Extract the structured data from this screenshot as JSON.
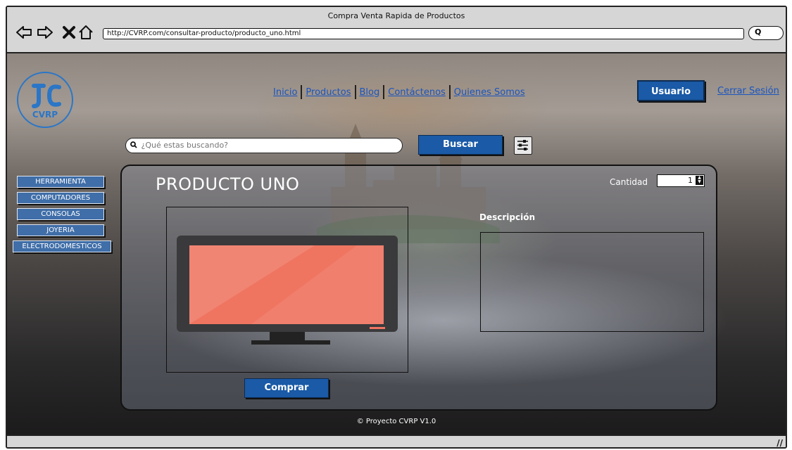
{
  "browser": {
    "window_title": "Compra Venta Rapida de Productos",
    "url": "http://CVRP.com/consultar-producto/producto_uno.html",
    "search_pill_glyph": "Q"
  },
  "header": {
    "logo_text": "CVRP",
    "nav": [
      {
        "label": "Inicio"
      },
      {
        "label": "Productos"
      },
      {
        "label": "Blog"
      },
      {
        "label": "Contáctenos"
      },
      {
        "label": "Quienes Somos"
      }
    ],
    "user_button": "Usuario",
    "logout_link": "Cerrar Sesión"
  },
  "search": {
    "placeholder": "¿Qué estas buscando?",
    "button": "Buscar"
  },
  "categories": [
    {
      "label": "HERRAMIENTA"
    },
    {
      "label": "COMPUTADORES"
    },
    {
      "label": "CONSOLAS"
    },
    {
      "label": "JOYERIA"
    },
    {
      "label": "ELECTRODOMESTICOS"
    }
  ],
  "product": {
    "title": "PRODUCTO UNO",
    "quantity_label": "Cantidad",
    "quantity_value": "1",
    "description_label": "Descripción",
    "buy_button": "Comprar"
  },
  "footer": {
    "text": "© Proyecto CVRP V1.0"
  },
  "colors": {
    "button_blue": "#1a5aa6",
    "link_blue": "#1a55c0",
    "monitor_screen": "#ef7561",
    "logo_blue": "#2b76c7"
  }
}
